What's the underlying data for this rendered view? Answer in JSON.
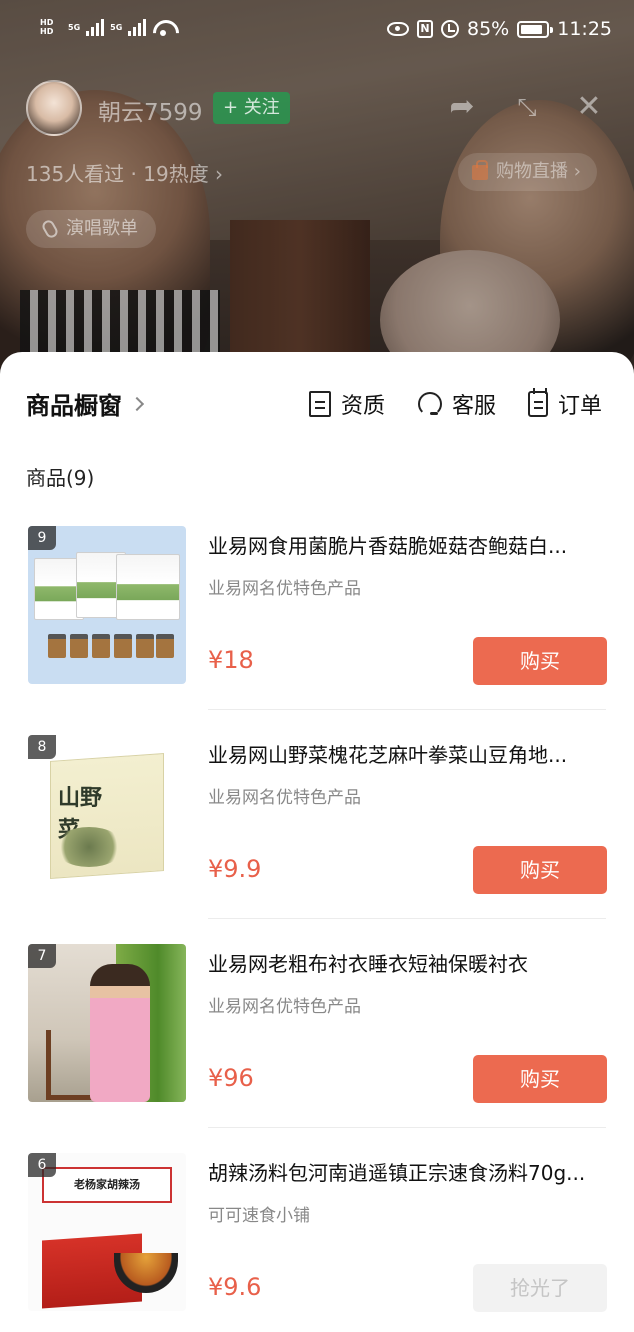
{
  "status_bar": {
    "sim1_tag": "HD 5G",
    "sim2_tag": "HD 5G",
    "battery": "85%",
    "time": "11:25"
  },
  "live_header": {
    "anchor_name": "朝云7599",
    "follow_label": "+ 关注",
    "stats": "135人看过 · 19热度 ›",
    "shop_live_label": "购物直播 ›",
    "sing_list_label": "演唱歌单",
    "icons": [
      "share-icon",
      "minimize-icon",
      "close-icon"
    ]
  },
  "sheet": {
    "title": "商品橱窗",
    "tools": [
      {
        "label": "资质",
        "icon": "document-icon"
      },
      {
        "label": "客服",
        "icon": "headset-icon"
      },
      {
        "label": "订单",
        "icon": "clipboard-icon"
      }
    ],
    "count_label": "商品(9)"
  },
  "products": [
    {
      "rank": "9",
      "title": "业易网食用菌脆片香菇脆姬菇杏鲍菇白...",
      "shop": "业易网名优特色产品",
      "price": "¥18",
      "button": "购买",
      "sold_out": false
    },
    {
      "rank": "8",
      "title": "业易网山野菜槐花芝麻叶拳菜山豆角地...",
      "shop": "业易网名优特色产品",
      "price": "¥9.9",
      "button": "购买",
      "sold_out": false
    },
    {
      "rank": "7",
      "title": "业易网老粗布衬衣睡衣短袖保暖衬衣",
      "shop": "业易网名优特色产品",
      "price": "¥96",
      "button": "购买",
      "sold_out": false
    },
    {
      "rank": "6",
      "title": "胡辣汤料包河南逍遥镇正宗速食汤料70g...",
      "shop": "可可速食小铺",
      "price": "¥9.6",
      "button": "抢光了",
      "sold_out": true
    }
  ],
  "thumb_text": {
    "p8_logo": "山野菜",
    "p6_band": "老杨家胡辣汤"
  },
  "colors": {
    "accent": "#ec6a50",
    "price": "#e8604a",
    "follow": "#20a050"
  }
}
